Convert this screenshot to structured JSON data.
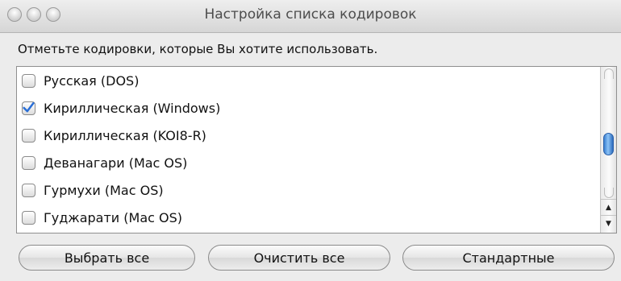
{
  "window": {
    "title": "Настройка списка кодировок"
  },
  "instruction": "Отметьте кодировки, которые Вы хотите использовать.",
  "encodings": [
    {
      "label": "Русская (DOS)",
      "checked": false
    },
    {
      "label": "Кириллическая (Windows)",
      "checked": true
    },
    {
      "label": "Кириллическая (KOI8-R)",
      "checked": false
    },
    {
      "label": "Деванагари (Mac OS)",
      "checked": false
    },
    {
      "label": "Гурмухи (Mac OS)",
      "checked": false
    },
    {
      "label": "Гуджарати (Mac OS)",
      "checked": false
    }
  ],
  "buttons": {
    "select_all": "Выбрать все",
    "clear_all": "Очистить все",
    "defaults": "Стандартные"
  },
  "colors": {
    "check_mark": "#2a6fd6",
    "scroll_thumb": "#3a7fd1"
  },
  "icons": {
    "close": "close-icon",
    "minimize": "minimize-icon",
    "zoom": "zoom-icon",
    "check": "checkmark-icon"
  }
}
